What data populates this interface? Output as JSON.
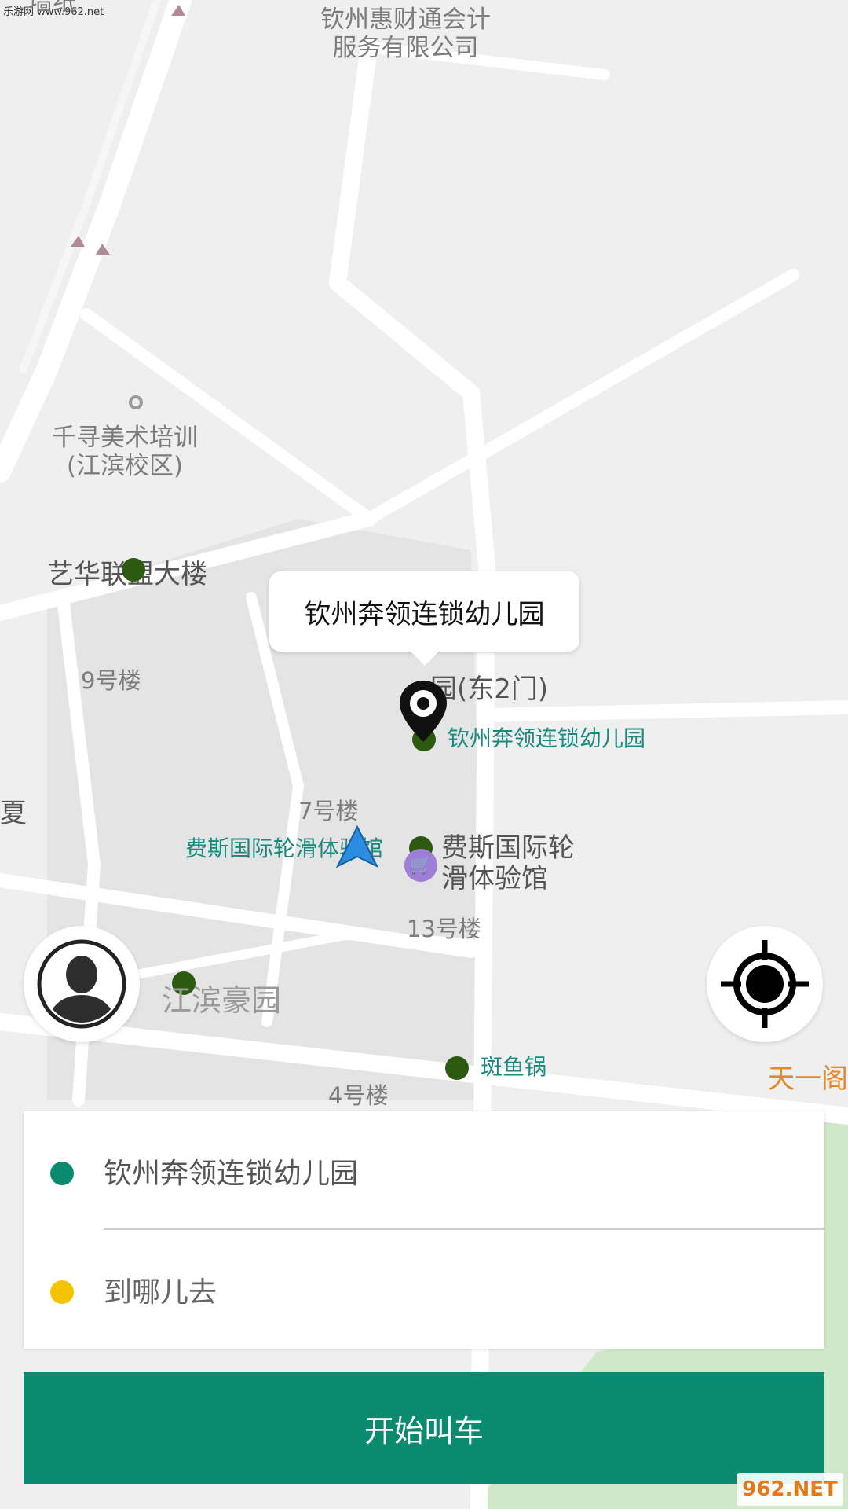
{
  "watermark_top": "乐游网 www.962.net",
  "map": {
    "labels": {
      "company": "钦州惠财通会计\n服务有限公司",
      "art_school": "千寻美术培训\n(江滨校区)",
      "league_building": "艺华联盟大楼",
      "building9": "9号楼",
      "building7": "7号楼",
      "building13": "13号楼",
      "building4": "4号楼",
      "kindergarten_gate": "园(东2门)",
      "kindergarten_poi": "钦州奔领连锁幼儿园",
      "skate_left": "费斯国际轮滑体验馆",
      "skate_right": "费斯国际轮\n滑体验馆",
      "jiangbin": "江滨豪园",
      "fish_pot": "斑鱼锅",
      "tianyi": "天一阁",
      "xia": "夏",
      "top_left": "墙纸"
    }
  },
  "popup": {
    "location_name": "钦州奔领连锁幼儿园"
  },
  "trip": {
    "origin": "钦州奔领连锁幼儿园",
    "destination_placeholder": "到哪儿去",
    "origin_color": "#0a8a6e",
    "destination_color": "#f5c400"
  },
  "cta": {
    "label": "开始叫车"
  },
  "watermark_bottom": "962.NET"
}
